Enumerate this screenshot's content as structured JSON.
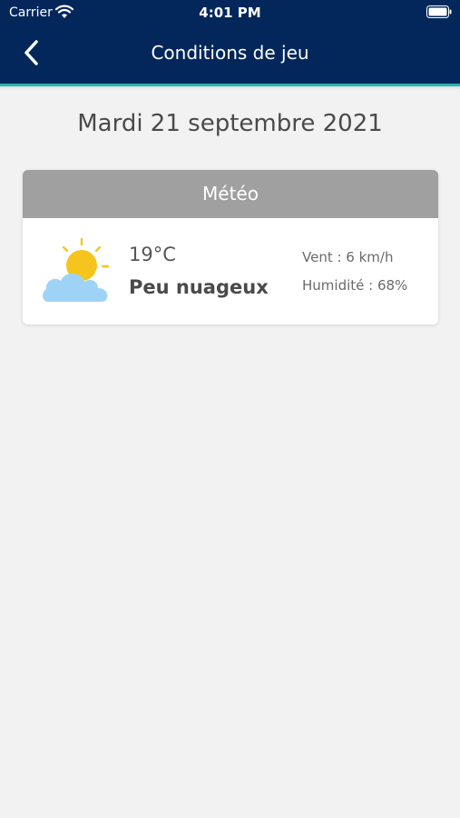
{
  "status_bar": {
    "carrier": "Carrier",
    "time": "4:01 PM"
  },
  "header": {
    "title": "Conditions de jeu",
    "back_icon": "chevron-left-icon"
  },
  "date": "Mardi 21 septembre 2021",
  "weather_card": {
    "title": "Météo",
    "icon": "partly-cloudy-icon",
    "temperature": "19°C",
    "condition": "Peu nuageux",
    "wind": "Vent : 6 km/h",
    "humidity": "Humidité : 68%"
  },
  "colors": {
    "header_bg": "#03275b",
    "header_accent": "#2bb3b3",
    "card_header_bg": "#a0a0a0",
    "page_bg": "#f2f2f2",
    "sun": "#f5c51d",
    "cloud": "#9fd3f5"
  }
}
